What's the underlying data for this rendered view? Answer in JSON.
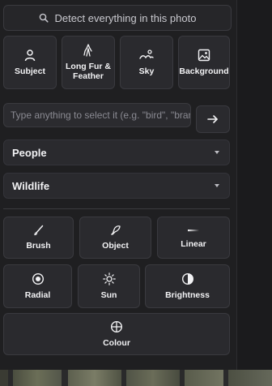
{
  "detect": {
    "label": "Detect everything in this photo",
    "icon": "search-icon"
  },
  "subjects": [
    {
      "label": "Subject",
      "icon": "person-icon"
    },
    {
      "label": "Long Fur & Feather",
      "icon": "fur-icon"
    },
    {
      "label": "Sky",
      "icon": "sky-icon"
    },
    {
      "label": "Background",
      "icon": "image-icon"
    }
  ],
  "prompt": {
    "placeholder": "Type anything to select it (e.g. \"bird\", \"bran",
    "submit_icon": "arrow-right-icon"
  },
  "dropdowns": [
    {
      "label": "People"
    },
    {
      "label": "Wildlife"
    }
  ],
  "tools_row1": [
    {
      "label": "Brush",
      "icon": "brush-icon"
    },
    {
      "label": "Object",
      "icon": "object-icon"
    },
    {
      "label": "Linear",
      "icon": "linear-gradient-icon"
    }
  ],
  "tools_row2": [
    {
      "label": "Radial",
      "icon": "radial-gradient-icon"
    },
    {
      "label": "Sun",
      "icon": "sun-icon"
    },
    {
      "label": "Brightness",
      "icon": "brightness-icon"
    }
  ],
  "tools_row3": [
    {
      "label": "Colour",
      "icon": "colour-icon"
    }
  ]
}
